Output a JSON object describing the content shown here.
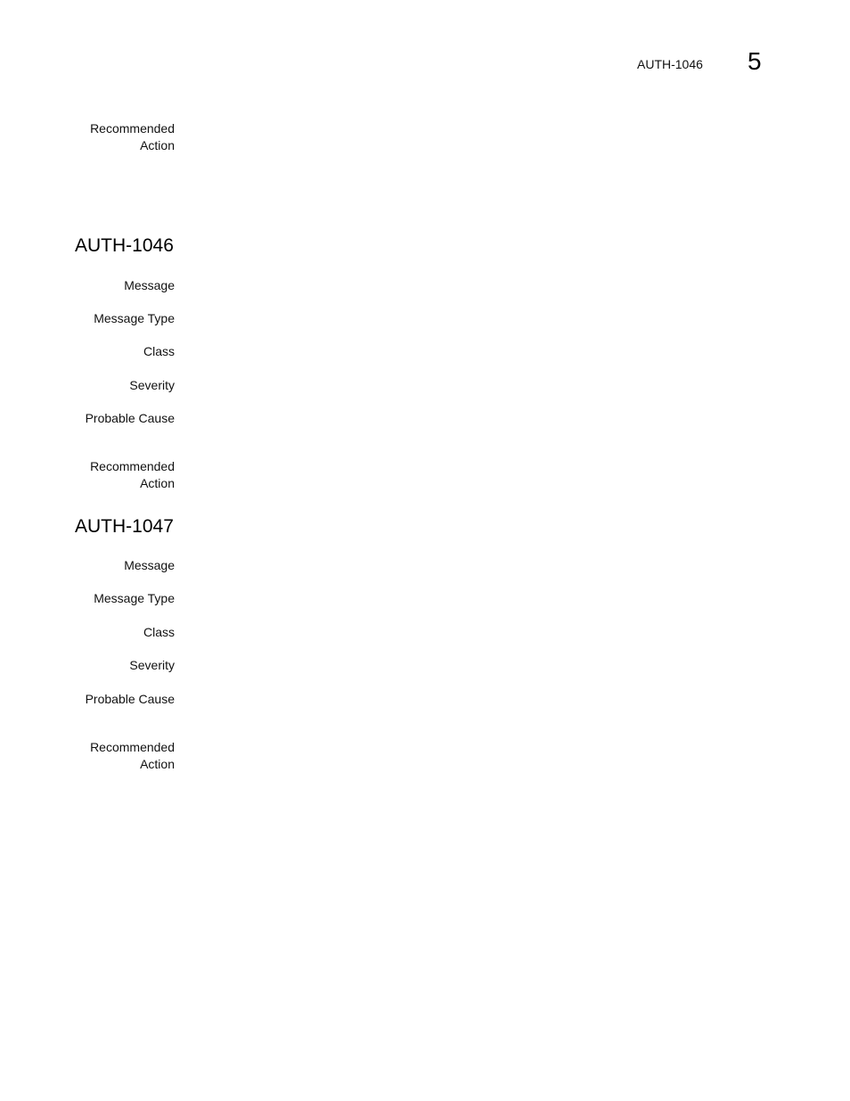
{
  "header": {
    "running_title": "AUTH-1046",
    "chapter_number": "5"
  },
  "top_fragment": {
    "recommended_action_label_line1": "Recommended",
    "recommended_action_label_line2": "Action"
  },
  "sections": [
    {
      "title": "AUTH-1046",
      "labels": {
        "message": "Message",
        "message_type": "Message Type",
        "class": "Class",
        "severity": "Severity",
        "probable_cause": "Probable Cause",
        "recommended_action_line1": "Recommended",
        "recommended_action_line2": "Action"
      }
    },
    {
      "title": "AUTH-1047",
      "labels": {
        "message": "Message",
        "message_type": "Message Type",
        "class": "Class",
        "severity": "Severity",
        "probable_cause": "Probable Cause",
        "recommended_action_line1": "Recommended",
        "recommended_action_line2": "Action"
      }
    }
  ]
}
